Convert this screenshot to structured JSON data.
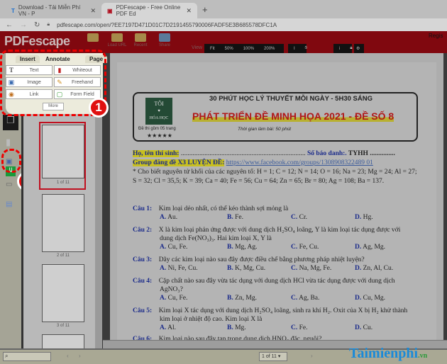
{
  "browser": {
    "tabs": [
      {
        "label": "Download - Tải Miễn Phí VN - P"
      },
      {
        "label": "PDFescape - Free Online PDF Ed"
      }
    ],
    "url": "pdfescape.com/open/?EE7197D471D01C7D2191455790006FADF5E3B685578DFC1A"
  },
  "header": {
    "logo": "PDFescape",
    "buttons": [
      "",
      "Load URL",
      "Recent",
      "Share"
    ],
    "view_label": "View",
    "zoom": [
      "Fit",
      "50%",
      "100%",
      "200%"
    ],
    "register": "Regis"
  },
  "panel": {
    "tabs": [
      "Insert",
      "Annotate",
      "Page"
    ],
    "tools": [
      {
        "label": "Text",
        "icon": "T"
      },
      {
        "label": "Whiteout"
      },
      {
        "label": "Image"
      },
      {
        "label": "Freehand"
      },
      {
        "label": "Link"
      },
      {
        "label": "Form Field"
      }
    ],
    "more": "More"
  },
  "badges": [
    "1",
    "2"
  ],
  "thumbs": [
    "1 of 11",
    "2 of 11",
    "3 of 11"
  ],
  "doc": {
    "banner_top": "30 PHÚT HỌC LÝ THUYẾT MỖI NGÀY - 5H30 SÁNG",
    "banner_title": "PHÁT TRIỂN ĐỀ MINH HỌA 2021 - ĐỀ SỐ 8",
    "banner_time": "Thời gian làm bài: 50 phút",
    "logo_text": [
      "TÔI",
      "♥",
      "HÓA HỌC"
    ],
    "pages_note": "Đề thi gồm 05 trang",
    "stars": "★★★★★",
    "name_label": "Họ, tên thí sinh:",
    "name_dots": " ..........................................................................",
    "sbd_label": "Số báo danh:.",
    "sbd_value": " TYHH ...............",
    "group_label": "Group đăng đề X3 LUYỆN ĐỀ:",
    "group_link": "https://www.facebook.com/groups/1308908322489 01",
    "atomic": "* Cho biết nguyên tử khối của các nguyên tố: H = 1; C = 12; N = 14; O = 16; Na = 23; Mg = 24; Al = 27;",
    "atomic2": "S = 32; Cl = 35,5; K = 39; Ca = 40; Fe = 56; Cu = 64; Zn = 65; Br = 80; Ag = 108; Ba = 137.",
    "questions": [
      {
        "num": "Câu 1:",
        "text": "Kim loại dẻo nhất, có thể kéo thành sợi mỏng là",
        "text2": "",
        "opts": [
          "Au.",
          "Fe.",
          "Cr.",
          "Hg."
        ]
      },
      {
        "num": "Câu 2:",
        "text": "X là kim loại phản ứng được với dung dịch H₂SO₄ loãng, Y là kim loại tác dụng được với",
        "text2": "dung dịch Fe(NO₃)₃. Hai kim loại X, Y là",
        "opts": [
          "Cu, Fe.",
          "Mg, Ag.",
          "Fe, Cu.",
          "Ag, Mg."
        ]
      },
      {
        "num": "Câu 3:",
        "text": "Dãy các kim loại nào sau đây được điều chế bằng phương pháp nhiệt luyện?",
        "text2": "",
        "opts": [
          "Ni, Fe, Cu.",
          "K, Mg, Cu.",
          "Na, Mg, Fe.",
          "Zn, Al, Cu."
        ]
      },
      {
        "num": "Câu 4:",
        "text": "Cặp chất nào sau đây vừa tác dụng với dung dịch HCl vừa tác dụng được với dung dịch",
        "text2": "AgNO₃?",
        "opts": [
          "Cu, Fe.",
          "Zn, Mg.",
          "Ag, Ba.",
          "Cu, Mg."
        ]
      },
      {
        "num": "Câu 5:",
        "text": "Kim loại X tác dụng với dung dịch H₂SO₄ loãng, sinh ra khí H₂. Oxit của X bị H₂ khử thành",
        "text2": "kim loại ở nhiệt độ cao. Kim loại X là",
        "opts": [
          "Al.",
          "Mg.",
          "Fe.",
          "Cu."
        ]
      },
      {
        "num": "Câu 6:",
        "text": "Kim loại nào sau đây tan trong dung dịch HNO₃ đặc, nguội?",
        "text2": "",
        "opts": []
      }
    ],
    "letters": [
      "A.",
      "B.",
      "C.",
      "D."
    ]
  },
  "bottom": {
    "page_select": "1 of 11",
    "prev": "‹",
    "next": "›",
    "watermark": "Taimienphi",
    "watermark_sub": ".vn"
  }
}
